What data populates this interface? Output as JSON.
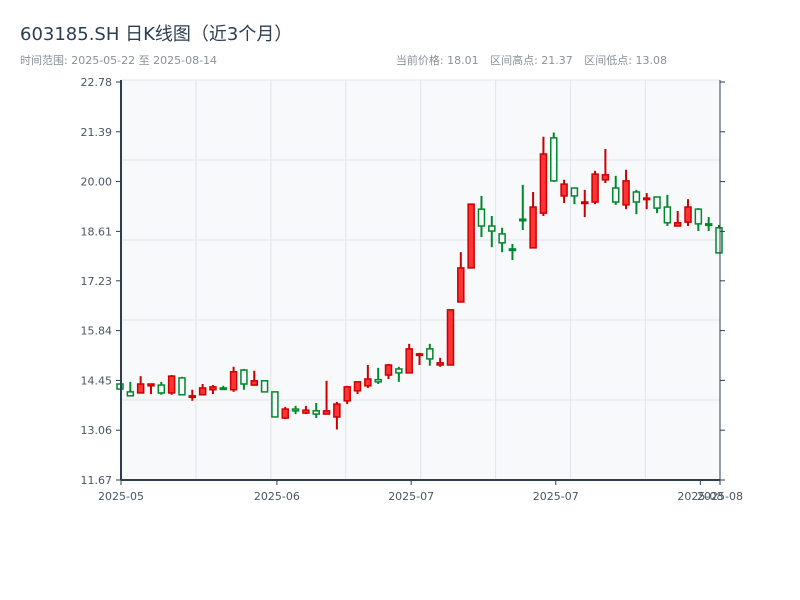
{
  "header": {
    "title": "603185.SH 日K线图（近3个月）",
    "subtitle": "时间范围: 2025-05-22 至 2025-08-14",
    "current_price": "当前价格: 18.01",
    "range_high": "区间高点: 21.37",
    "range_low": "区间低点: 13.08"
  },
  "colors": {
    "up_fill": "#ff3333",
    "up_stroke": "#cc0000",
    "down_stroke": "#00882e",
    "plot_bg": "#f7f9fb",
    "axis": "#2c3e50",
    "grid": "#e1e4e8"
  },
  "chart_data": {
    "type": "candlestick",
    "title": "603185.SH 日K线图（近3个月）",
    "ylim": [
      11.67,
      22.78
    ],
    "yticks": [
      "11.67",
      "13.06",
      "14.45",
      "15.84",
      "17.23",
      "18.61",
      "20.00",
      "21.39",
      "22.78"
    ],
    "xticks": [
      {
        "label": "2025-05",
        "index": 0
      },
      {
        "label": "2025-06",
        "index": 15
      },
      {
        "label": "2025-07",
        "index": 28
      },
      {
        "label": "2025-07",
        "index": 42
      },
      {
        "label": "2025-08",
        "index": 56
      },
      {
        "label": "2025-08",
        "index": 58
      }
    ],
    "ohlc": [
      [
        14.35,
        14.35,
        14.21,
        14.21
      ],
      [
        14.13,
        14.41,
        14.02,
        14.02
      ],
      [
        14.1,
        14.57,
        14.1,
        14.35
      ],
      [
        14.3,
        14.35,
        14.07,
        14.35
      ],
      [
        14.32,
        14.41,
        14.05,
        14.1
      ],
      [
        14.1,
        14.6,
        14.05,
        14.57
      ],
      [
        14.52,
        14.55,
        14.05,
        14.05
      ],
      [
        13.99,
        14.19,
        13.88,
        14.02
      ],
      [
        14.05,
        14.35,
        14.05,
        14.24
      ],
      [
        14.19,
        14.32,
        14.07,
        14.27
      ],
      [
        14.24,
        14.3,
        14.19,
        14.21
      ],
      [
        14.19,
        14.83,
        14.13,
        14.69
      ],
      [
        14.74,
        14.77,
        14.19,
        14.35
      ],
      [
        14.32,
        14.72,
        14.3,
        14.44
      ],
      [
        14.44,
        14.44,
        14.13,
        14.13
      ],
      [
        14.13,
        14.13,
        13.43,
        13.43
      ],
      [
        13.4,
        13.71,
        13.37,
        13.65
      ],
      [
        13.65,
        13.74,
        13.51,
        13.6
      ],
      [
        13.54,
        13.74,
        13.51,
        13.62
      ],
      [
        13.6,
        13.82,
        13.4,
        13.51
      ],
      [
        13.51,
        14.44,
        13.51,
        13.6
      ],
      [
        13.43,
        13.85,
        13.08,
        13.79
      ],
      [
        13.88,
        14.3,
        13.79,
        14.27
      ],
      [
        14.16,
        14.41,
        14.07,
        14.41
      ],
      [
        14.3,
        14.88,
        14.24,
        14.49
      ],
      [
        14.47,
        14.8,
        14.35,
        14.41
      ],
      [
        14.6,
        14.91,
        14.49,
        14.88
      ],
      [
        14.77,
        14.83,
        14.41,
        14.66
      ],
      [
        14.66,
        15.47,
        14.66,
        15.33
      ],
      [
        15.16,
        15.22,
        14.88,
        15.19
      ],
      [
        15.33,
        15.47,
        14.86,
        15.05
      ],
      [
        14.88,
        15.08,
        14.83,
        14.94
      ],
      [
        14.88,
        16.42,
        14.88,
        16.42
      ],
      [
        16.64,
        18.03,
        16.64,
        17.59
      ],
      [
        17.59,
        19.37,
        17.59,
        19.37
      ],
      [
        19.23,
        19.6,
        18.45,
        18.76
      ],
      [
        18.76,
        19.04,
        18.17,
        18.62
      ],
      [
        18.54,
        18.71,
        18.03,
        18.29
      ],
      [
        18.12,
        18.26,
        17.81,
        18.09
      ],
      [
        18.95,
        19.91,
        18.65,
        18.93
      ],
      [
        18.15,
        19.71,
        18.15,
        19.29
      ],
      [
        19.12,
        21.25,
        19.04,
        20.77
      ],
      [
        21.22,
        21.37,
        19.99,
        20.02
      ],
      [
        19.6,
        20.05,
        19.4,
        19.93
      ],
      [
        19.82,
        19.82,
        19.37,
        19.6
      ],
      [
        19.4,
        19.77,
        19.01,
        19.43
      ],
      [
        19.43,
        20.3,
        19.37,
        20.21
      ],
      [
        20.05,
        20.91,
        19.96,
        20.19
      ],
      [
        19.82,
        20.16,
        19.35,
        19.43
      ],
      [
        19.35,
        20.33,
        19.23,
        20.02
      ],
      [
        19.71,
        19.77,
        19.09,
        19.43
      ],
      [
        19.51,
        19.68,
        19.23,
        19.54
      ],
      [
        19.57,
        19.57,
        19.12,
        19.26
      ],
      [
        19.29,
        19.63,
        18.76,
        18.85
      ],
      [
        18.76,
        19.18,
        18.76,
        18.85
      ],
      [
        18.87,
        19.51,
        18.76,
        19.29
      ],
      [
        19.23,
        19.26,
        18.62,
        18.82
      ],
      [
        18.82,
        19.01,
        18.62,
        18.79
      ],
      [
        18.71,
        18.79,
        18.01,
        18.01
      ]
    ],
    "ohlc_order": [
      "open",
      "high",
      "low",
      "close"
    ]
  }
}
